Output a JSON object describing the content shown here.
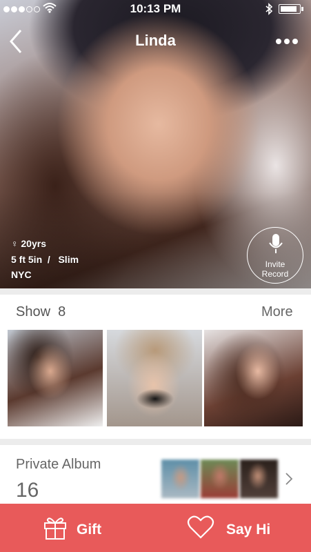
{
  "status_bar": {
    "time": "10:13 PM",
    "signal_dots_filled": 3,
    "signal_dots_total": 5,
    "battery_level": 0.9
  },
  "header": {
    "back_icon": "chevron-left-icon",
    "title": "Linda",
    "more_icon": "ellipsis-icon"
  },
  "profile": {
    "age": "20yrs",
    "gender_icon": "female-icon",
    "height": "5 ft 5in",
    "separator": "/",
    "build": "Slim",
    "location": "NYC"
  },
  "invite": {
    "icon": "microphone-icon",
    "line1": "Invite",
    "line2": "Record"
  },
  "show": {
    "label": "Show",
    "count": "8",
    "more": "More"
  },
  "album": {
    "label": "Private Album",
    "count": "16",
    "chevron_icon": "chevron-right-icon"
  },
  "actions": {
    "gift_label": "Gift",
    "gift_icon": "gift-icon",
    "say_hi_label": "Say Hi",
    "say_hi_icon": "heart-icon"
  },
  "colors": {
    "accent": "#e85a5a",
    "text_gray": "#666666",
    "separator": "#ececec"
  }
}
